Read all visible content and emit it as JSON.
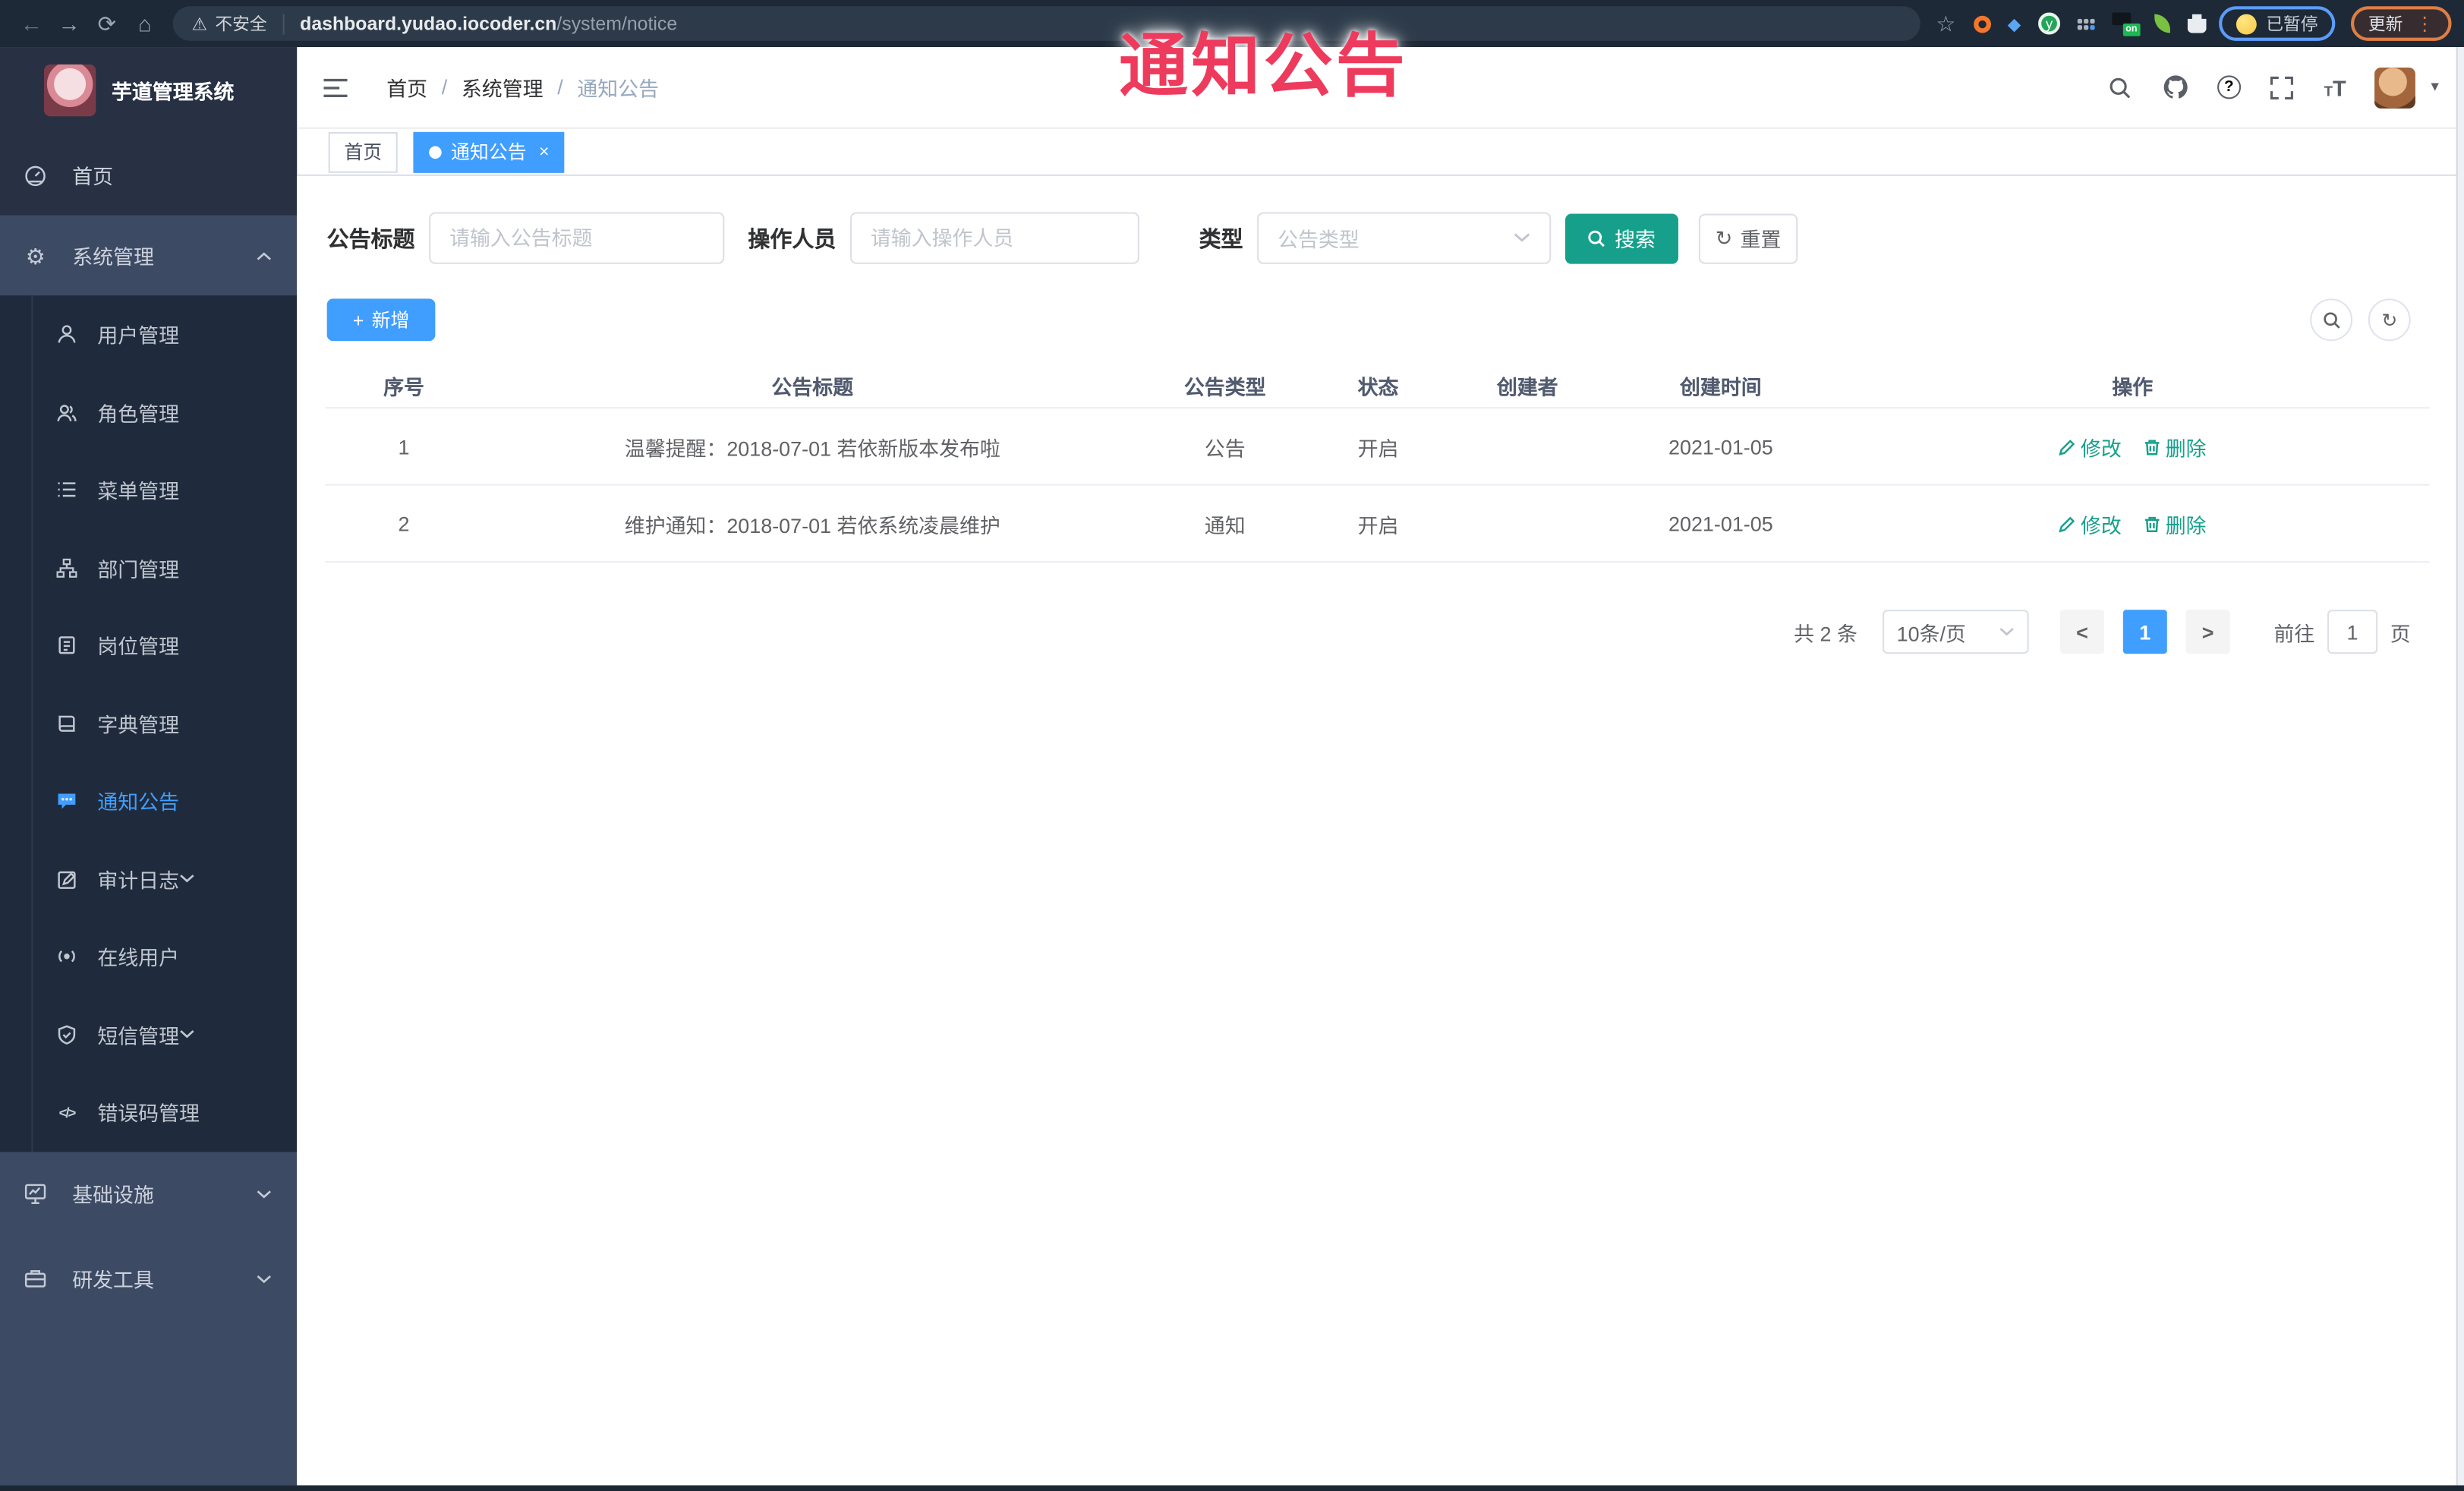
{
  "browser": {
    "security_warning": "不安全",
    "url_host": "dashboard.yudao.iocoder.cn",
    "url_path": "/system/notice",
    "paused_badge": "已暂停",
    "update_button": "更新",
    "extension_on_badge": "on",
    "extension_y_letter": "y"
  },
  "icons": {
    "back": "←",
    "forward": "→",
    "reload": "⟳",
    "home": "⌂",
    "warning": "⚠",
    "star": "☆",
    "drop": "◆",
    "dots_vertical": "⋮",
    "gear": "⚙",
    "code": "</>",
    "plus": "+",
    "refresh": "↻",
    "close": "×",
    "caret_down": "▾",
    "page_prev": "<",
    "page_next": ">",
    "question": "?",
    "font_size_large": "T",
    "font_size_small": "T"
  },
  "overlay": {
    "title": "通知公告",
    "color": "#ee3a5c"
  },
  "sidebar": {
    "app_title": "芋道管理系统",
    "items": [
      {
        "label": "首页"
      },
      {
        "label": "系统管理",
        "state": "expanded"
      },
      {
        "label": "用户管理"
      },
      {
        "label": "角色管理"
      },
      {
        "label": "菜单管理"
      },
      {
        "label": "部门管理"
      },
      {
        "label": "岗位管理"
      },
      {
        "label": "字典管理"
      },
      {
        "label": "通知公告",
        "state": "active"
      },
      {
        "label": "审计日志"
      },
      {
        "label": "在线用户"
      },
      {
        "label": "短信管理"
      },
      {
        "label": "错误码管理"
      },
      {
        "label": "基础设施"
      },
      {
        "label": "研发工具"
      }
    ]
  },
  "header": {
    "breadcrumb": {
      "0": "首页",
      "1": "系统管理",
      "2": "通知公告"
    },
    "separator": "/"
  },
  "tabs": {
    "0": {
      "label": "首页"
    },
    "1": {
      "label": "通知公告"
    }
  },
  "filters": {
    "title_label": "公告标题",
    "title_placeholder": "请输入公告标题",
    "operator_label": "操作人员",
    "operator_placeholder": "请输入操作人员",
    "type_label": "类型",
    "type_placeholder": "公告类型",
    "search_button": "搜索",
    "reset_button": "重置"
  },
  "toolbar": {
    "add_button": "新增"
  },
  "table": {
    "columns": {
      "0": "序号",
      "1": "公告标题",
      "2": "公告类型",
      "3": "状态",
      "4": "创建者",
      "5": "创建时间",
      "6": "操作"
    },
    "rows": [
      {
        "no": "1",
        "title": "温馨提醒：2018-07-01 若依新版本发布啦",
        "type": "公告",
        "status": "开启",
        "creator": "",
        "create_time": "2021-01-05",
        "actions": {
          "edit": "修改",
          "delete": "删除"
        }
      },
      {
        "no": "2",
        "title": "维护通知：2018-07-01 若依系统凌晨维护",
        "type": "通知",
        "status": "开启",
        "creator": "",
        "create_time": "2021-01-05",
        "actions": {
          "edit": "修改",
          "delete": "删除"
        }
      }
    ]
  },
  "pagination": {
    "total_text": "共 2 条",
    "page_size": "10条/页",
    "current_page": "1",
    "goto_label": "前往",
    "goto_value": "1",
    "page_unit": "页"
  },
  "colors": {
    "primary_blue": "#409eff",
    "theme_teal": "#16a08c",
    "chrome_dark": "#1d2936",
    "sidebar_dark": "#1f2b3c",
    "sidebar_mid": "#3c4a64",
    "overlay_red": "#ee3a5c"
  }
}
